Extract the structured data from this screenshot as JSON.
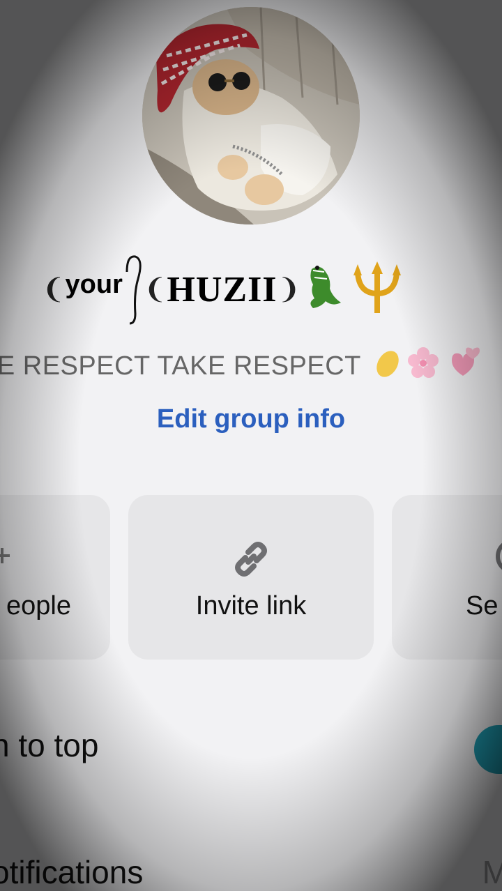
{
  "group": {
    "name_prefix": "your",
    "name_main": "HUZII",
    "description": "VE RESPECT TAKE RESPECT",
    "edit_label": "Edit group info"
  },
  "actions": [
    {
      "label": "eople",
      "icon": "add-people-icon"
    },
    {
      "label": "Invite link",
      "icon": "link-icon"
    },
    {
      "label": "Se",
      "icon": "search-icon"
    }
  ],
  "rows": {
    "pin_label": "n to top",
    "notifications_label": "otifications",
    "notifications_value": "M"
  },
  "colors": {
    "accent": "#2b5fbe",
    "toggle_on": "#1f9fb5",
    "card_bg": "#e6e6e8",
    "page_bg": "#f2f2f4"
  }
}
